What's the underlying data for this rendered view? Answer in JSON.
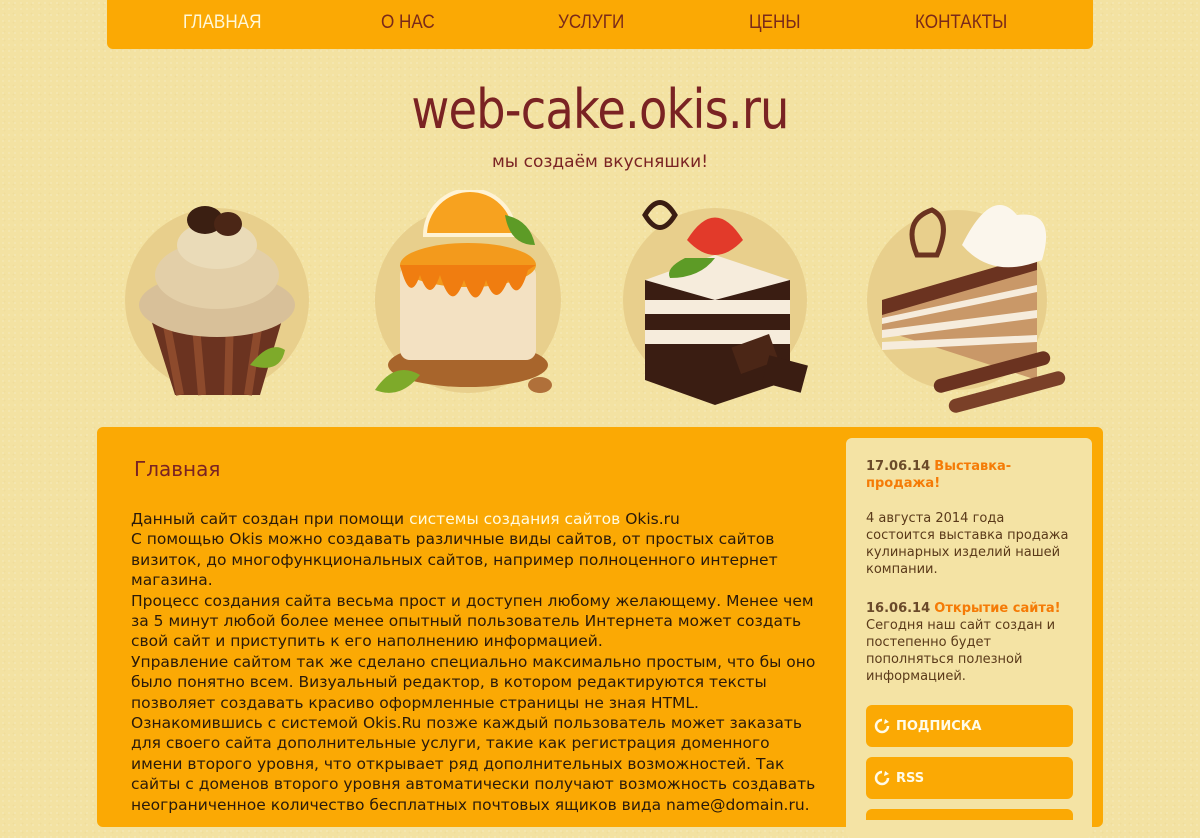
{
  "nav": {
    "items": [
      {
        "label": "ГЛАВНАЯ"
      },
      {
        "label": "О НАС"
      },
      {
        "label": "УСЛУГИ"
      },
      {
        "label": "ЦЕНЫ"
      },
      {
        "label": "КОНТАКТЫ"
      }
    ]
  },
  "header": {
    "title": "web-cake.okis.ru",
    "tagline": "мы создаём вкусняшки!"
  },
  "main": {
    "title": "Главная",
    "p1_prefix": "Данный сайт создан при помощи ",
    "p1_link": "системы создания сайтов",
    "p1_suffix": " Okis.ru",
    "p2": "С помощью Okis можно создавать различные виды сайтов, от простых сайтов визиток, до многофункциональных сайтов, например полноценного интернет магазина.",
    "p3": "Процесс создания сайта весьма прост и доступен любому желающему. Менее чем за 5 минут любой более менее опытный пользователь Интернета может создать свой сайт и приступить к его наполнению информацией.",
    "p4": "Управление сайтом так же сделано специально максимально простым, что бы оно было понятно всем. Визуальный редактор, в котором редактируются тексты позволяет создавать красиво оформленные страницы не зная HTML.",
    "p5": "Ознакомившись с системой Okis.Ru позже каждый пользователь может заказать для своего сайта дополнительные услуги, такие как регистрация доменного имени второго уровня, что открывает ряд дополнительных возможностей. Так сайты с доменов второго уровня автоматически получают возможность создавать неограниченное количество бесплатных почтовых ящиков вида name@domain.ru."
  },
  "sidebar": {
    "news": [
      {
        "date": "17.06.14",
        "title": "Выставка-продажа!",
        "text": "4 августа 2014 года состоится выставка продажа кулинарных изделий нашей компании."
      },
      {
        "date": "16.06.14",
        "title": "Открытие сайта!",
        "text": "Сегодня наш сайт создан и постепенно будет пополняться полезной информацией."
      }
    ],
    "buttons": [
      {
        "label": "ПОДПИСКА",
        "icon": "refresh-icon"
      },
      {
        "label": "RSS",
        "icon": "refresh-icon"
      }
    ]
  },
  "colors": {
    "accent": "#fba904",
    "title": "#7a2323",
    "link": "#f57b06"
  }
}
